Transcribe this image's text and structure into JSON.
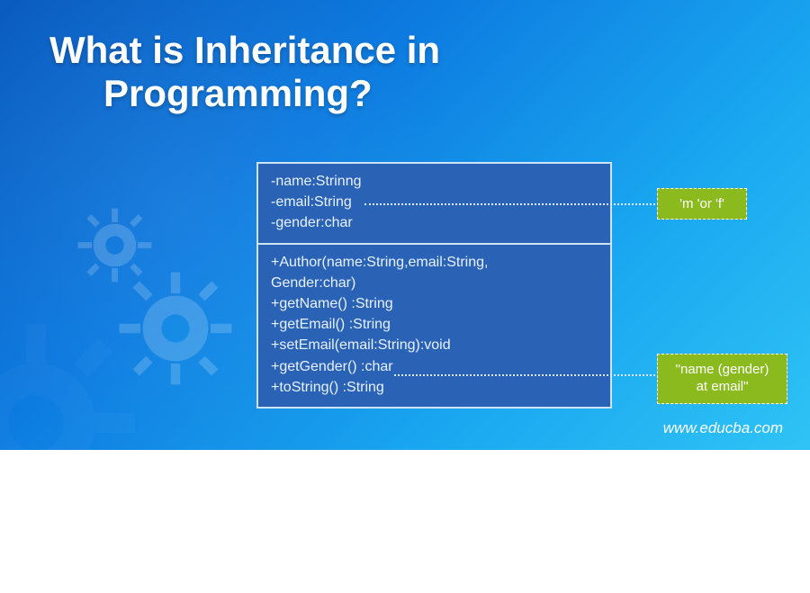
{
  "title_line1": "What is Inheritance in",
  "title_line2": "Programming?",
  "uml": {
    "attributes": [
      "-name:Strinng",
      "-email:String",
      "-gender:char"
    ],
    "methods": [
      "+Author(name:String,email:String,",
      "Gender:char)",
      "+getName() :String",
      "+getEmail() :String",
      "+setEmail(email:String):void",
      "+getGender() :char",
      "+toString() :String"
    ]
  },
  "annotations": {
    "gender_values": "'m 'or 'f'",
    "tostring_format": "\"name (gender) at email\""
  },
  "footer": "www.educba.com",
  "colors": {
    "box_bg": "#2a62b5",
    "box_border": "#cfe3f7",
    "annot_bg": "#8bba1f"
  }
}
